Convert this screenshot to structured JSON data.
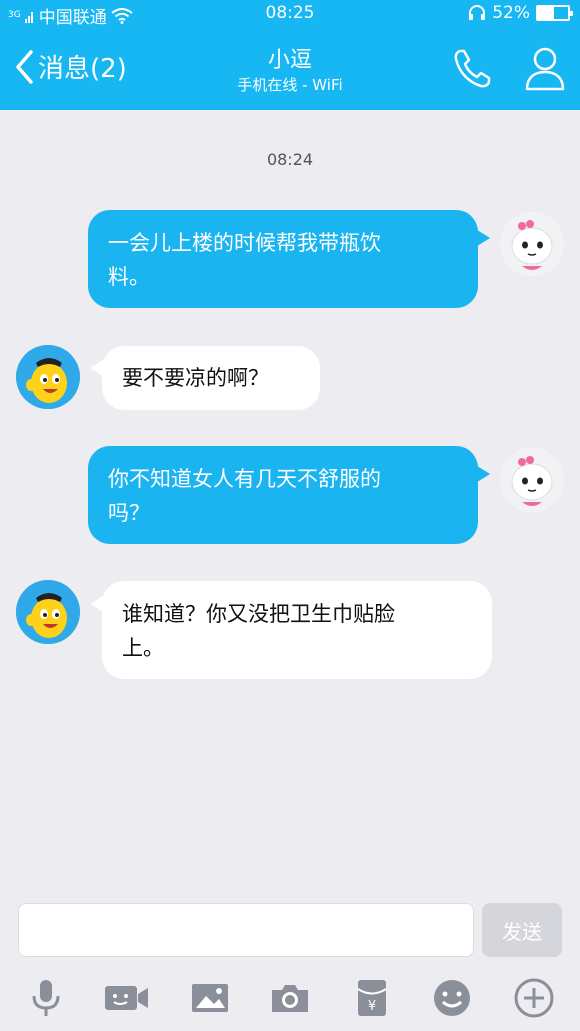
{
  "status_bar": {
    "signal_tag": "3G",
    "carrier": "中国联通",
    "time": "08:25",
    "battery_text": "52%",
    "battery_level": 0.52
  },
  "header": {
    "back_label": "消息(2)",
    "title": "小逗",
    "subtitle": "手机在线 - WiFi"
  },
  "chat": {
    "timestamp": "08:24",
    "messages": [
      {
        "sender": "me",
        "lines": [
          "一会儿上楼的时候帮我带瓶饮",
          "料。"
        ]
      },
      {
        "sender": "other",
        "lines": [
          "要不要凉的啊？"
        ]
      },
      {
        "sender": "me",
        "lines": [
          "你不知道女人有几天不舒服的",
          "吗？"
        ]
      },
      {
        "sender": "other",
        "lines": [
          "谁知道？你又没把卫生巾贴脸",
          "上。"
        ]
      }
    ]
  },
  "composer": {
    "input_value": "",
    "send_label": "发送"
  },
  "toolbar_icons": [
    "microphone-icon",
    "video-icon",
    "image-icon",
    "camera-icon",
    "red-packet-icon",
    "emoji-icon",
    "plus-icon"
  ],
  "colors": {
    "brand_blue": "#16b7f2",
    "bubble_me": "#1ab4f1",
    "bubble_other": "#ffffff",
    "background": "#ececf1",
    "icon_gray": "#8a8f99"
  }
}
